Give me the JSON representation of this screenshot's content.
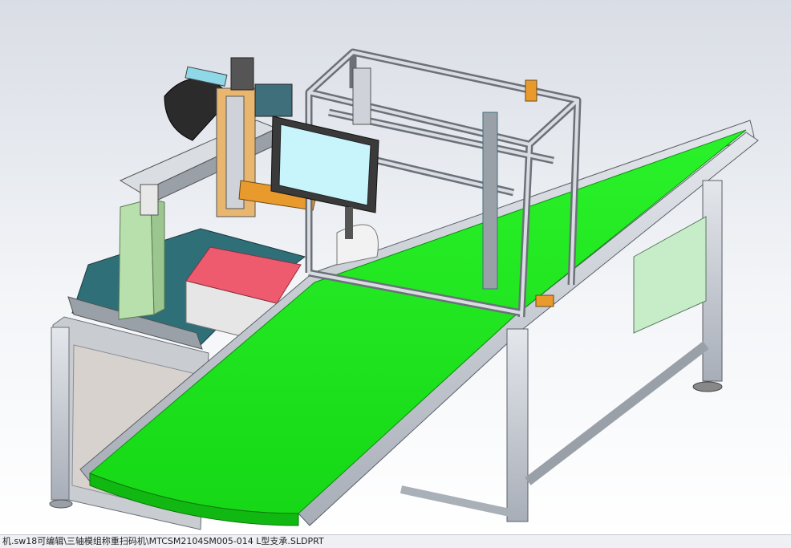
{
  "status_bar": {
    "file_path": "机.sw18可编辑\\三轴模组称重扫码机\\MTCSM2104SM005-014 L型支承.SLDPRT"
  },
  "colors": {
    "belt": "#1ee61e",
    "aluminum": "#c9ced6",
    "base_plate": "#2e6f78",
    "monitor_screen": "#c8f4fb",
    "box_top": "#ef5b6e",
    "bracket": "#b8e0ad",
    "accent_orange": "#e99a2c"
  },
  "icons": [
    "cad-3d-model"
  ]
}
